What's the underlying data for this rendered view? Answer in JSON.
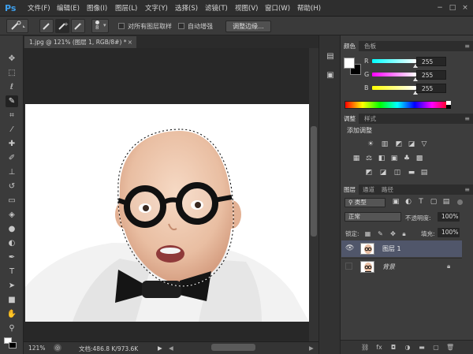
{
  "app": {
    "logo": "Ps"
  },
  "menu": [
    "文件(F)",
    "编辑(E)",
    "图像(I)",
    "图层(L)",
    "文字(Y)",
    "选择(S)",
    "滤镜(T)",
    "视图(V)",
    "窗口(W)",
    "帮助(H)"
  ],
  "window_buttons": [
    "−",
    "□",
    "×"
  ],
  "options": {
    "brush_size": "8",
    "sample_all_layers": "对所有图层取样",
    "auto_enhance": "自动增强",
    "refine_edge": "调整边缘..."
  },
  "document": {
    "tab_title": "1.jpg @ 121% (图层 1, RGB/8#) *",
    "zoom": "121%",
    "doc_size": "文档:486.8 K/973.6K"
  },
  "color_panel": {
    "tabs": [
      "颜色",
      "色板"
    ],
    "channels": [
      {
        "label": "R",
        "value": "255"
      },
      {
        "label": "G",
        "value": "255"
      },
      {
        "label": "B",
        "value": "255"
      }
    ],
    "foreground": "#ffffff",
    "background": "#000000"
  },
  "adjustments_panel": {
    "tabs": [
      "调整",
      "样式"
    ],
    "title": "添加调整"
  },
  "layers_panel": {
    "tabs": [
      "图层",
      "通道",
      "路径"
    ],
    "filter_kind": "类型",
    "blend_mode": "正常",
    "opacity_label": "不透明度:",
    "opacity_value": "100%",
    "lock_label": "锁定:",
    "fill_label": "填充:",
    "fill_value": "100%",
    "layers": [
      {
        "name": "图层 1",
        "selected": true,
        "visible": true
      },
      {
        "name": "背景",
        "selected": false,
        "visible": false,
        "locked": true
      }
    ]
  },
  "colors": {
    "accent": "#3ea0ee",
    "panel": "#3d3d3d",
    "selected_layer": "#50566a"
  }
}
